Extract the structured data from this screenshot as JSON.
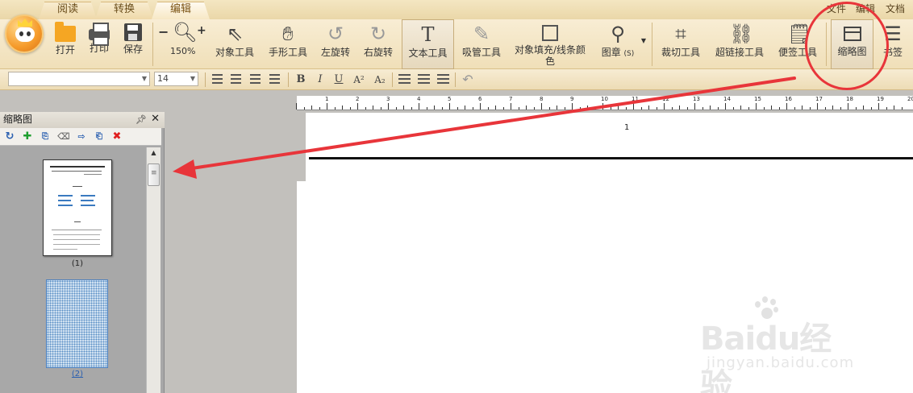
{
  "tabs": [
    {
      "label": "阅读"
    },
    {
      "label": "转换"
    },
    {
      "label": "编辑"
    }
  ],
  "top_menu": [
    "文件",
    "编辑",
    "文档"
  ],
  "ribbon": {
    "open": "打开",
    "print": "打印",
    "save": "保存",
    "zoom_value": "150%",
    "zoom_out": "−",
    "zoom_in": "+",
    "object_tool": "对象工具",
    "hand_tool": "手形工具",
    "rotate_left": "左旋转",
    "rotate_right": "右旋转",
    "text_tool": "文本工具",
    "eyedropper": "吸管工具",
    "fill_color": "对象填充/线条颜色",
    "stamp": "图章",
    "stamp_key": "(S)",
    "crop_tool": "裁切工具",
    "hyperlink_tool": "超链接工具",
    "note_tool": "便签工具",
    "thumbnail": "缩略图",
    "bookmark": "书签"
  },
  "format_bar": {
    "font_value": "",
    "size_value": "14",
    "bold": "B",
    "italic": "I",
    "underline": "U",
    "superscript": "A²",
    "subscript": "A₂"
  },
  "panel": {
    "title": "缩略图",
    "pin": "ᵽ",
    "close": "✕",
    "thumbs": [
      {
        "label": "(1)"
      },
      {
        "label": "(2)"
      }
    ]
  },
  "ruler": {
    "ticks": [
      "1",
      "2",
      "3",
      "4",
      "5",
      "6",
      "7",
      "8",
      "9",
      "10",
      "11",
      "12",
      "13",
      "14",
      "15",
      "16",
      "17",
      "18",
      "19",
      "20"
    ]
  },
  "document": {
    "page_number": "1"
  },
  "watermark": {
    "brand": "Baidu经验",
    "url": "jingyan.baidu.com"
  },
  "colors": {
    "accent_red": "#e8353a",
    "ribbon_bg": "#f0dfb8"
  }
}
